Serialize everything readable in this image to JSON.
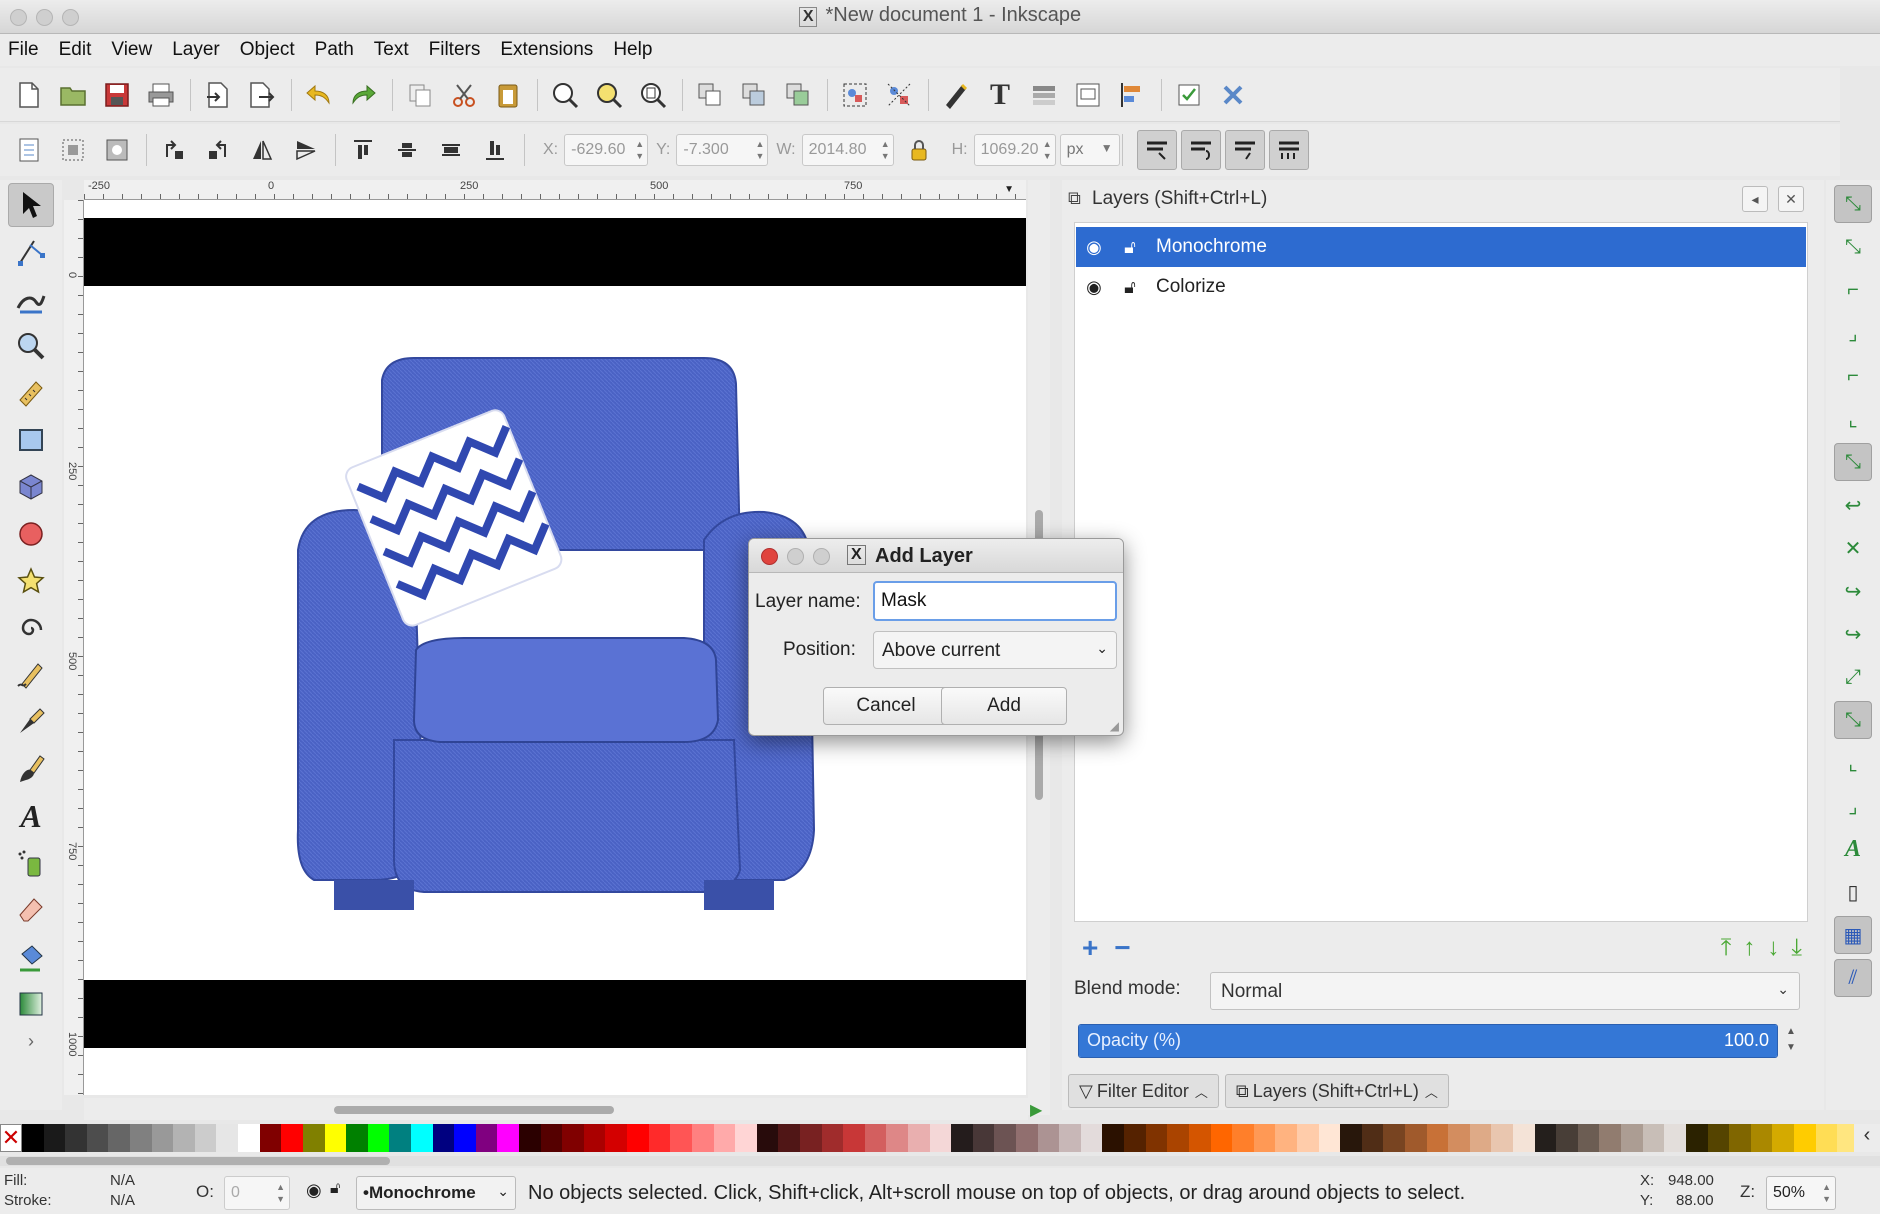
{
  "window": {
    "title": "*New document 1 - Inkscape",
    "x_glyph": "X"
  },
  "menu": [
    "File",
    "Edit",
    "View",
    "Layer",
    "Object",
    "Path",
    "Text",
    "Filters",
    "Extensions",
    "Help"
  ],
  "toolbar2": {
    "x_label": "X:",
    "x_value": "-629.60",
    "y_label": "Y:",
    "y_value": "-7.300",
    "w_label": "W:",
    "w_value": "2014.80",
    "h_label": "H:",
    "h_value": "1069.20",
    "unit": "px"
  },
  "rulers": {
    "top": [
      "-250",
      "0",
      "250",
      "500",
      "750"
    ],
    "left": [
      "0",
      "250",
      "500",
      "750",
      "1000"
    ]
  },
  "dock": {
    "title": "Layers (Shift+Ctrl+L)",
    "layers": [
      {
        "name": "Monochrome",
        "selected": true
      },
      {
        "name": "Colorize",
        "selected": false
      }
    ],
    "blend_label": "Blend mode:",
    "blend_value": "Normal",
    "opacity_label": "Opacity (%)",
    "opacity_value": "100.0",
    "opacity_fraction": 1.0,
    "tabs": [
      "Filter Editor",
      "Layers (Shift+Ctrl+L)"
    ]
  },
  "dialog": {
    "title": "Add Layer",
    "x_glyph": "X",
    "name_label": "Layer name:",
    "name_value": "Mask",
    "position_label": "Position:",
    "position_value": "Above current",
    "cancel_label": "Cancel",
    "add_label": "Add"
  },
  "status": {
    "fill_label": "Fill:",
    "fill_value": "N/A",
    "stroke_label": "Stroke:",
    "stroke_value": "N/A",
    "opacity_label": "O:",
    "opacity_value": "0",
    "current_layer": "•Monochrome",
    "message": "No objects selected. Click, Shift+click, Alt+scroll mouse on top of objects, or drag around objects to select.",
    "cursor_x_label": "X:",
    "cursor_x": "948.00",
    "cursor_y_label": "Y:",
    "cursor_y": "88.00",
    "zoom_label": "Z:",
    "zoom": "50%"
  },
  "colors": {
    "selection_blue": "#2d6bd0",
    "chair_blue": "#4a62c4",
    "snap_green": "#2c8a3a",
    "close_red": "#e0443e"
  },
  "palette": [
    "#000000",
    "#1a1a1a",
    "#333333",
    "#4d4d4d",
    "#666666",
    "#808080",
    "#999999",
    "#b3b3b3",
    "#cccccc",
    "#e6e6e6",
    "#ffffff",
    "#800000",
    "#ff0000",
    "#808000",
    "#ffff00",
    "#008000",
    "#00ff00",
    "#008080",
    "#00ffff",
    "#000080",
    "#0000ff",
    "#800080",
    "#ff00ff",
    "#2b0000",
    "#550000",
    "#800000",
    "#aa0000",
    "#d40000",
    "#ff0000",
    "#ff2a2a",
    "#ff5555",
    "#ff8080",
    "#ffaaaa",
    "#ffd5d5",
    "#280b0b",
    "#501616",
    "#782121",
    "#a02c2c",
    "#c83737",
    "#d35f5f",
    "#de8787",
    "#e9afaf",
    "#f4d7d7",
    "#241c1c",
    "#483737",
    "#6c5353",
    "#916f6f",
    "#ac9393",
    "#c8b7b7",
    "#e3dbdb",
    "#2b1100",
    "#552200",
    "#803300",
    "#aa4400",
    "#d45500",
    "#ff6600",
    "#ff7f2a",
    "#ff9955",
    "#ffb380",
    "#ffccaa",
    "#ffe6d5",
    "#28170b",
    "#502d16",
    "#784421",
    "#a05a2c",
    "#c87137",
    "#d38d5f",
    "#deaa87",
    "#e9c6af",
    "#f4e3d7",
    "#241f1c",
    "#483e37",
    "#6c5d53",
    "#917c6f",
    "#ac9d93",
    "#c8beb7",
    "#e3dedb",
    "#2b2200",
    "#554400",
    "#806600",
    "#aa8800",
    "#d4aa00",
    "#ffcc00",
    "#ffdd55",
    "#ffe680",
    "#ffeeaa"
  ],
  "icons": {
    "tools": [
      "selector-icon",
      "node-icon",
      "tweak-icon",
      "zoom-icon",
      "measure-icon",
      "rect-icon",
      "box3d-icon",
      "ellipse-icon",
      "star-icon",
      "spiral-icon",
      "pencil-icon",
      "pen-icon",
      "calligraphy-icon",
      "text-icon",
      "spray-icon",
      "eraser-icon",
      "bucket-icon",
      "gradient-icon"
    ]
  }
}
